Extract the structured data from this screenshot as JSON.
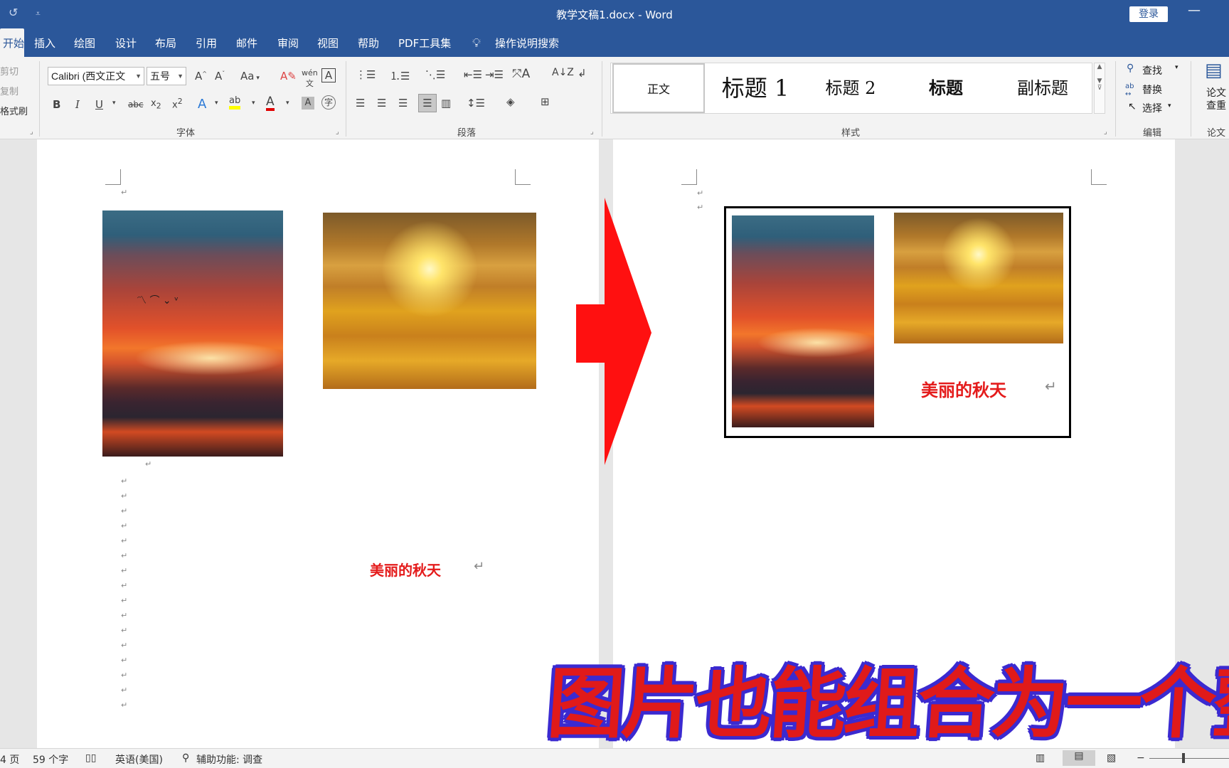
{
  "titlebar": {
    "undo_icon": "undo-icon",
    "customize_icon": "customize-qat-icon",
    "title": "教学文稿1.docx  -  Word",
    "login": "登录",
    "minimize_icon": "minimize-icon"
  },
  "tabs": [
    {
      "label": "开始"
    },
    {
      "label": "插入"
    },
    {
      "label": "绘图"
    },
    {
      "label": "设计"
    },
    {
      "label": "布局"
    },
    {
      "label": "引用"
    },
    {
      "label": "邮件"
    },
    {
      "label": "审阅"
    },
    {
      "label": "视图"
    },
    {
      "label": "帮助"
    },
    {
      "label": "PDF工具集"
    }
  ],
  "tellme": "操作说明搜索",
  "clipboard": {
    "cut": "剪切",
    "copy": "复制",
    "format_painter": "格式刷"
  },
  "font": {
    "font_name": "Calibri (西文正文",
    "font_size": "五号",
    "group_label": "字体",
    "grow": "A˄",
    "shrink": "A˅",
    "case": "Aa",
    "bold": "B",
    "italic": "I",
    "underline": "U",
    "strike": "abc",
    "subscript": "x₂",
    "superscript": "x²",
    "font_color_letter": "A",
    "highlight_color": "#ffff00",
    "font_color": "#e00000"
  },
  "paragraph": {
    "group_label": "段落"
  },
  "styles": {
    "group_label": "样式",
    "items": [
      {
        "label": "正文"
      },
      {
        "label": "标题 1"
      },
      {
        "label": "标题 2"
      },
      {
        "label": "标题"
      },
      {
        "label": "副标题"
      }
    ]
  },
  "editing": {
    "group_label": "编辑",
    "find": "查找",
    "replace": "替换",
    "select": "选择"
  },
  "paper": {
    "group_label": "论文",
    "button_line1": "论文",
    "button_line2": "查重"
  },
  "document": {
    "left_caption": "美丽的秋天",
    "right_caption": "美丽的秋天",
    "headline": "图片也能组合为一个整体",
    "arrow_color": "#ff1010",
    "headline_fill": "#e01a1a",
    "headline_stroke": "#3b2ad0"
  },
  "statusbar": {
    "page": "4 页",
    "words": "59 个字",
    "language": "英语(美国)",
    "accessibility": "辅助功能: 调查"
  }
}
